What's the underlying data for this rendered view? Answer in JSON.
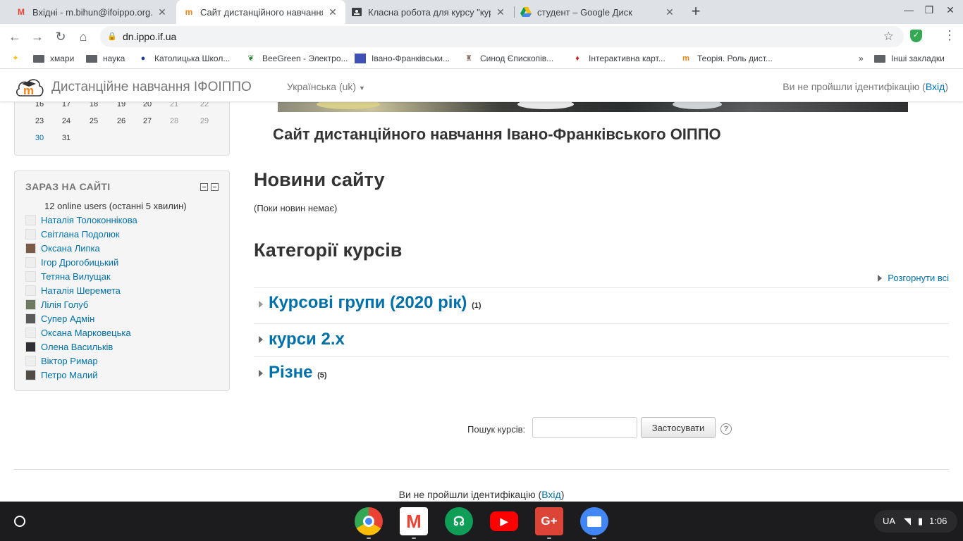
{
  "browser": {
    "tabs": [
      {
        "title": "Вхідні - m.bihun@ifoippo.org.ua",
        "icon": "gmail-icon",
        "active": false
      },
      {
        "title": "Сайт дистанційного навчання",
        "icon": "moodle-icon",
        "active": true
      },
      {
        "title": "Класна робота для курсу \"курс",
        "icon": "classroom-icon",
        "active": false
      },
      {
        "title": "студент – Google Диск",
        "icon": "drive-icon",
        "active": false
      }
    ],
    "url": "dn.ippo.if.ua",
    "bookmarks": [
      {
        "label": "хмари",
        "icon": "folder-icon"
      },
      {
        "label": "наука",
        "icon": "folder-icon"
      },
      {
        "label": "Католицька Школ...",
        "icon": "site-icon"
      },
      {
        "label": "BeeGreen - Электро...",
        "icon": "site-icon"
      },
      {
        "label": "Івано-Франківськи...",
        "icon": "site-icon"
      },
      {
        "label": "Синод Єпископів...",
        "icon": "site-icon"
      },
      {
        "label": "Інтерактивна карт...",
        "icon": "map-pin-icon"
      },
      {
        "label": "Теорія. Роль дист...",
        "icon": "moodle-icon"
      }
    ],
    "more_bookmarks": "»",
    "other_bookmarks": "Інші закладки"
  },
  "navbar": {
    "site_name": "Дистанційне навчання ІФОІППО",
    "language": "Українська (uk)",
    "not_logged_in": "Ви не пройшли ідентифікацію (",
    "login_link": "Вхід",
    "close_paren": ")"
  },
  "calendar": {
    "rows": [
      [
        "16",
        "17",
        "18",
        "19",
        "20",
        "21",
        "22"
      ],
      [
        "23",
        "24",
        "25",
        "26",
        "27",
        "28",
        "29"
      ],
      [
        "30",
        "31"
      ]
    ]
  },
  "online_block": {
    "title": "ЗАРАЗ НА САЙТІ",
    "count_text": "12 online users (останні 5 хвилин)",
    "users": [
      {
        "name": "Наталія Толоконнікова",
        "photo": false
      },
      {
        "name": "Світлана Подолюк",
        "photo": false
      },
      {
        "name": "Оксана Липка",
        "photo": true
      },
      {
        "name": "Ігор Дрогобицький",
        "photo": false
      },
      {
        "name": "Тетяна Вилущак",
        "photo": false
      },
      {
        "name": "Наталія Шеремета",
        "photo": false
      },
      {
        "name": "Лілія Голуб",
        "photo": true
      },
      {
        "name": "Супер Адмін",
        "photo": true
      },
      {
        "name": "Оксана Марковецька",
        "photo": false
      },
      {
        "name": "Олена Васильків",
        "photo": true
      },
      {
        "name": "Віктор Римар",
        "photo": false
      },
      {
        "name": "Петро Малий",
        "photo": true
      }
    ]
  },
  "main": {
    "heading": "Сайт дистанційного навчання Івано-Франківського ОІППО",
    "news_title": "Новини сайту",
    "no_news": "(Поки новин немає)",
    "categories_title": "Категорії курсів",
    "expand_all": "Розгорнути всі",
    "categories": [
      {
        "name": "Курсові групи (2020 рік)",
        "count": "(1)"
      },
      {
        "name": "курси 2.x",
        "count": ""
      },
      {
        "name": "Різне",
        "count": "(5)"
      }
    ],
    "search_label": "Пошук курсів:",
    "search_value": "",
    "search_button": "Застосувати",
    "help": "?"
  },
  "footer": {
    "not_logged_in": "Ви не пройшли ідентифікацію (",
    "login_link": "Вхід",
    "close_paren": ")"
  },
  "shelf": {
    "apps": [
      {
        "name": "chrome",
        "color": "#4285f4"
      },
      {
        "name": "gmail",
        "color": "#ea4335"
      },
      {
        "name": "hangouts",
        "color": "#0f9d58"
      },
      {
        "name": "youtube",
        "color": "#ff0000"
      },
      {
        "name": "google-plus",
        "color": "#db4437"
      },
      {
        "name": "files",
        "color": "#4285f4"
      }
    ],
    "keyboard": "UA",
    "time": "1:06"
  },
  "colors": {
    "link": "#0070a8",
    "moodle_orange": "#f98012"
  }
}
